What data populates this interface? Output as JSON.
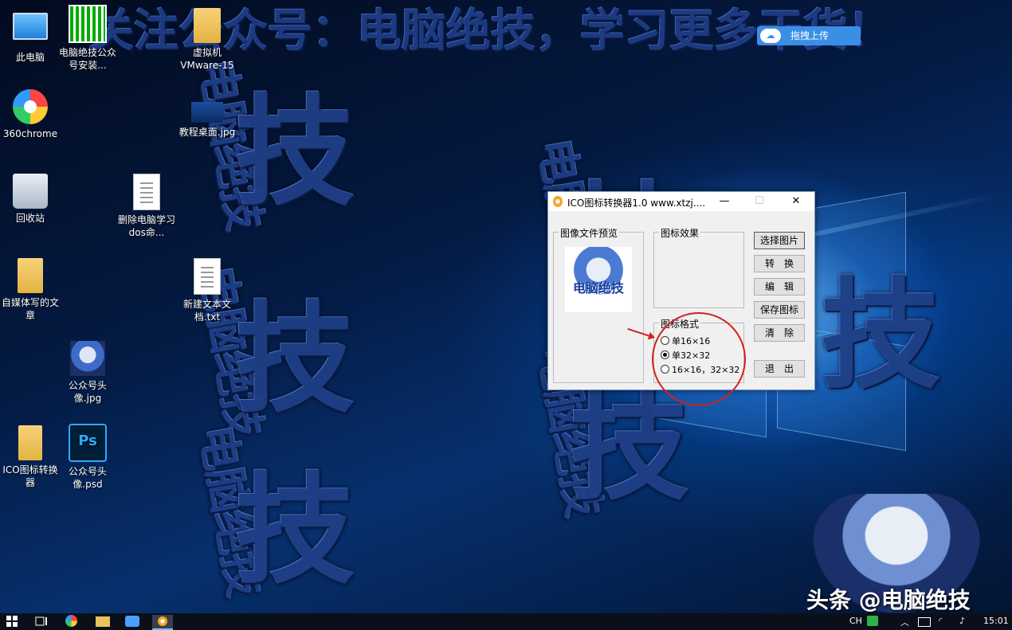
{
  "banner": "关注公众号：电脑绝技，学习更多干货！",
  "watermark_word": "电脑绝技",
  "watermark_char": "技",
  "upload_label": "拖拽上传",
  "desktop_icons": [
    {
      "label": "此电脑"
    },
    {
      "label": "电脑绝技公众号安装..."
    },
    {
      "label": "虚拟机VMware-15"
    },
    {
      "label": "360chrome"
    },
    {
      "label": "教程桌面.jpg"
    },
    {
      "label": "回收站"
    },
    {
      "label": "删除电脑学习dos命..."
    },
    {
      "label": "自媒体写的文章"
    },
    {
      "label": "新建文本文档.txt"
    },
    {
      "label": "公众号头像.jpg"
    },
    {
      "label": "ICO图标转换器"
    },
    {
      "label": "公众号头像.psd"
    }
  ],
  "ps_text": "Ps",
  "dialog": {
    "title": "ICO图标转换器1.0   www.xtzj....",
    "minimize": "—",
    "maximize": "☐",
    "close": "✕",
    "preview_group": "图像文件预览",
    "preview_text": "电脑绝技",
    "effect_group": "图标效果",
    "format_group": "图标格式",
    "options": [
      "单16×16",
      "单32×32",
      "16×16，32×32"
    ],
    "selected_option": 1,
    "buttons": [
      "选择图片",
      "转　换",
      "编　辑",
      "保存图标",
      "清　除",
      "退　出"
    ]
  },
  "watermark_corner": "头条 @电脑绝技",
  "taskbar": {
    "tray_lang": "CH",
    "clock": "15:01"
  },
  "colors": {
    "accent": "#3a8ee6",
    "annotation": "#d42020"
  }
}
